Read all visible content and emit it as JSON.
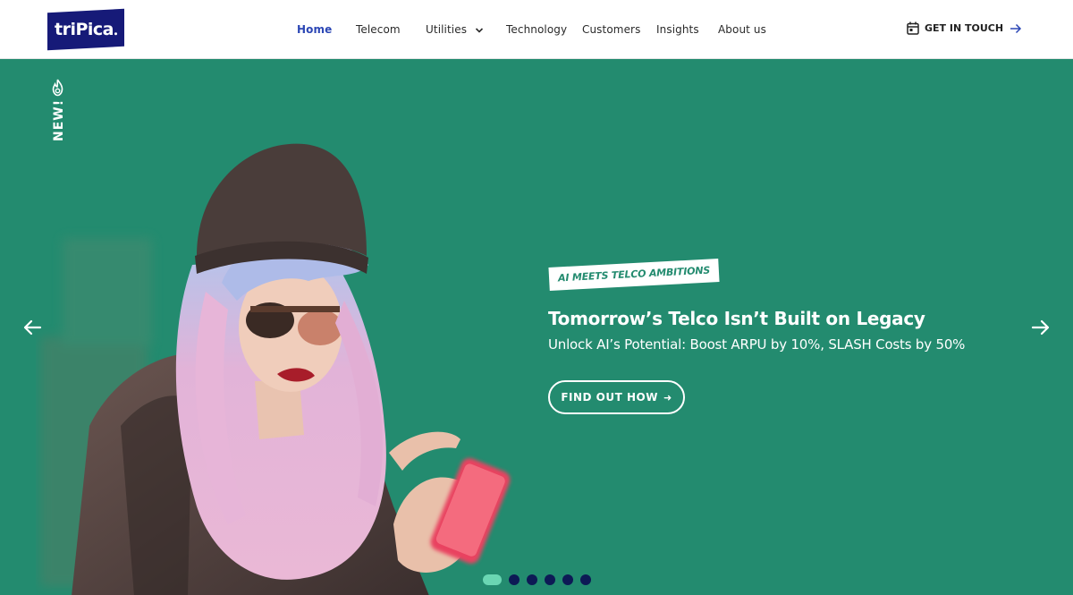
{
  "brand": {
    "logo_text": "triPica"
  },
  "nav": {
    "items": [
      {
        "label": "Home",
        "active": true
      },
      {
        "label": "Telecom"
      },
      {
        "label": "Utilities",
        "has_dropdown": true
      },
      {
        "label": "Technology"
      },
      {
        "label": "Customers"
      },
      {
        "label": "Insights"
      },
      {
        "label": "About us"
      }
    ],
    "cta_label": "GET IN TOUCH"
  },
  "hero": {
    "badge_text": "NEW!",
    "tag": "AI MEETS TELCO AMBITIONS",
    "headline": "Tomorrow’s Telco Isn’t Built on Legacy",
    "subline": "Unlock AI’s Potential: Boost ARPU by 10%, SLASH Costs by 50%",
    "button_label": "FIND OUT HOW",
    "button_arrow": "➜",
    "slides_total": 6,
    "active_slide": 1
  },
  "icons": {
    "calendar": "calendar-icon",
    "arrow_right": "arrow-right-icon",
    "flame": "flame-icon",
    "prev": "arrow-left-icon",
    "next": "arrow-right-icon",
    "chevron": "chevron-down-icon"
  },
  "colors": {
    "brand_navy": "#161a78",
    "hero_green": "#238b6f",
    "nav_active": "#2c47b5",
    "dot_active": "#6ad6b3",
    "dot_inactive": "#0d1a55"
  }
}
